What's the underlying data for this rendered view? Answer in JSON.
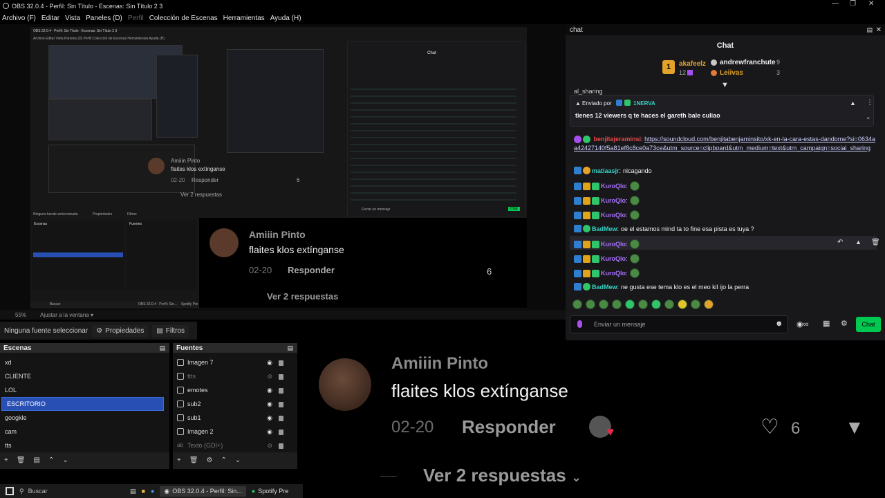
{
  "titlebar": {
    "title": "OBS 32.0.4 - Perfil: Sin Título - Escenas: Sin Título 2 3"
  },
  "menu": {
    "items": [
      "Archivo (F)",
      "Editar",
      "Vista",
      "Paneles (D)",
      "Perfil",
      "Colección de Escenas",
      "Herramientas",
      "Ayuda (H)"
    ]
  },
  "preview": {
    "zoom": "55%",
    "fit_label": "Ajustar a la ventana",
    "nested_title": "OBS 32.0.4 - Perfil: Sin Título - Escenas: Sin Título 2 3",
    "nested_menu": "Archivo  Editar  Vista  Paneles (D)  Perfil  Colección de Escenas  Herramientas  Ayuda (H)",
    "nested_comment_name": "Amiiin Pinto",
    "nested_comment_text": "flaites klos extínganse",
    "nested_comment_date": "02-20",
    "nested_reply": "Responder",
    "nested_likes": "6",
    "nested_replies": "Ver 2 respuestas",
    "nested_chat_header": "Chat",
    "nested_chat_input": "Enviar un mensaje",
    "nested_chat_button": "Chat",
    "nested_no_source": "Ninguna fuente seleccionada",
    "nested_props": "Propiedades",
    "nested_filters": "Filtros",
    "nested_scenes_head": "Escenas",
    "nested_sources_head": "Fuentes",
    "nested_taskbar_search": "Buscar",
    "nested_taskbar_app": "OBS 32.0.4 - Perfil: Sin...",
    "nested_taskbar_spotify": "Spotify Pre"
  },
  "sourcebar": {
    "no_source": "Ninguna fuente seleccionar",
    "properties": "Propiedades",
    "filters": "Filtros"
  },
  "scenes": {
    "header": "Escenas",
    "items": [
      "xd",
      "CLIENTE",
      "LOL",
      "ESCRITORIO",
      "googkle",
      "cam",
      "tts"
    ],
    "active_index": 3
  },
  "sources": {
    "header": "Fuentes",
    "items": [
      {
        "name": "Imagen 7",
        "visible": true
      },
      {
        "name": "ttts",
        "visible": false
      },
      {
        "name": "emotes",
        "visible": true
      },
      {
        "name": "sub2",
        "visible": true
      },
      {
        "name": "sub1",
        "visible": true
      },
      {
        "name": "Imagen 2",
        "visible": true
      },
      {
        "name": "Texto (GDI+)",
        "visible": false
      }
    ]
  },
  "taskbar": {
    "search": "Buscar",
    "obs_app": "OBS 32.0.4 - Perfil: Sin...",
    "spotify": "Spotify Pre"
  },
  "comment": {
    "name": "Amiiin Pinto",
    "text": "flaites klos extínganse",
    "date": "02-20",
    "reply": "Responder",
    "likes": "6",
    "replies": "Ver 2 respuestas"
  },
  "chat": {
    "window_title": "chat",
    "header": "Chat",
    "leaderboard": {
      "first": {
        "rank": "1",
        "name": "akafeelz",
        "count": "12"
      },
      "second": {
        "name": "andrewfranchute",
        "count": "9"
      },
      "third": {
        "name": "Leiivas",
        "count": "3"
      }
    },
    "pinned": {
      "by_label": "Enviado por",
      "by_user": "1NERVA",
      "text": "tienes 12 viewers q te haces el gareth bale culiao"
    },
    "partial_top": "al_sharing",
    "messages": [
      {
        "user": "benjitajeraminsi",
        "text": "https://soundcloud.com/benjitabenjaminsito/xk-en-la-cara-estas-dandome?si=0634aa42427140f5a81ef8c8ce0a73ce&utm_source=clipboard&utm_medium=text&utm_campaign=social_sharing",
        "link": true
      },
      {
        "user": "matiaasjr",
        "text": "nicagando"
      },
      {
        "user": "KuroQlo",
        "text": ""
      },
      {
        "user": "KuroQlo",
        "text": ""
      },
      {
        "user": "KuroQlo",
        "text": ""
      },
      {
        "user": "BadMew",
        "text": "oe el estamos mind ta to fine esa pista es tuya ?"
      },
      {
        "user": "KuroQlo",
        "text": ""
      },
      {
        "user": "KuroQlo",
        "text": ""
      },
      {
        "user": "KuroQlo",
        "text": ""
      },
      {
        "user": "BadMew",
        "text": "ne gusta ese tema klo es el meo kil ijo la perra"
      }
    ],
    "input_placeholder": "Enviar un mensaje",
    "send_button": "Chat",
    "accent": "#00c850"
  },
  "colors": {
    "scene_active": "#284fb4",
    "chat_bg": "#18181b",
    "link": "#cfd2ff"
  }
}
